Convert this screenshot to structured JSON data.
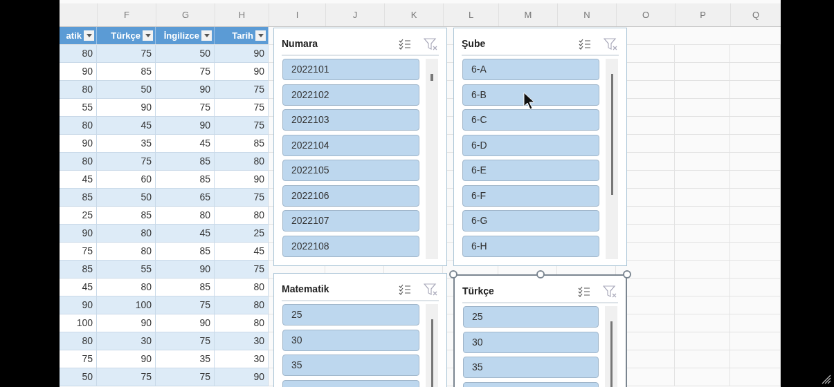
{
  "column_headers": [
    "F",
    "G",
    "H",
    "I",
    "J",
    "K",
    "L",
    "M",
    "N",
    "O",
    "P",
    "Q"
  ],
  "table": {
    "columns": [
      "atik",
      "Türkçe",
      "İngilizce",
      "Tarih"
    ],
    "rows": [
      [
        "80",
        "75",
        "50",
        "90"
      ],
      [
        "90",
        "85",
        "75",
        "90"
      ],
      [
        "80",
        "50",
        "90",
        "75"
      ],
      [
        "55",
        "90",
        "75",
        "75"
      ],
      [
        "80",
        "45",
        "90",
        "75"
      ],
      [
        "90",
        "35",
        "45",
        "85"
      ],
      [
        "80",
        "75",
        "85",
        "80"
      ],
      [
        "45",
        "60",
        "85",
        "90"
      ],
      [
        "85",
        "50",
        "65",
        "75"
      ],
      [
        "25",
        "85",
        "80",
        "80"
      ],
      [
        "90",
        "80",
        "45",
        "25"
      ],
      [
        "75",
        "80",
        "85",
        "45"
      ],
      [
        "85",
        "55",
        "90",
        "75"
      ],
      [
        "45",
        "80",
        "85",
        "80"
      ],
      [
        "90",
        "100",
        "75",
        "80"
      ],
      [
        "100",
        "90",
        "90",
        "80"
      ],
      [
        "80",
        "30",
        "75",
        "30"
      ],
      [
        "75",
        "90",
        "35",
        "30"
      ],
      [
        "50",
        "75",
        "75",
        "90"
      ]
    ]
  },
  "slicers": [
    {
      "title": "Numara",
      "selected": false,
      "long_scroll_thumb": false,
      "cut_off_item": false,
      "items": [
        {
          "label": "2022101",
          "selected": true
        },
        {
          "label": "2022102",
          "selected": true
        },
        {
          "label": "2022103",
          "selected": true
        },
        {
          "label": "2022104",
          "selected": true
        },
        {
          "label": "2022105",
          "selected": true
        },
        {
          "label": "2022106",
          "selected": true
        },
        {
          "label": "2022107",
          "selected": true
        },
        {
          "label": "2022108",
          "selected": true
        }
      ]
    },
    {
      "title": "Şube",
      "selected": false,
      "long_scroll_thumb": true,
      "cut_off_item": false,
      "items": [
        {
          "label": "6-A",
          "selected": true
        },
        {
          "label": "6-B",
          "selected": true
        },
        {
          "label": "6-C",
          "selected": true
        },
        {
          "label": "6-D",
          "selected": true
        },
        {
          "label": "6-E",
          "selected": true
        },
        {
          "label": "6-F",
          "selected": true
        },
        {
          "label": "6-G",
          "selected": true
        },
        {
          "label": "6-H",
          "selected": true
        }
      ]
    },
    {
      "title": "Matematik",
      "selected": false,
      "long_scroll_thumb": true,
      "cut_off_item": true,
      "items": [
        {
          "label": "25",
          "selected": true
        },
        {
          "label": "30",
          "selected": true
        },
        {
          "label": "35",
          "selected": true
        }
      ]
    },
    {
      "title": "Türkçe",
      "selected": true,
      "long_scroll_thumb": true,
      "cut_off_item": true,
      "items": [
        {
          "label": "25",
          "selected": true
        },
        {
          "label": "30",
          "selected": true
        },
        {
          "label": "35",
          "selected": true
        }
      ]
    }
  ]
}
